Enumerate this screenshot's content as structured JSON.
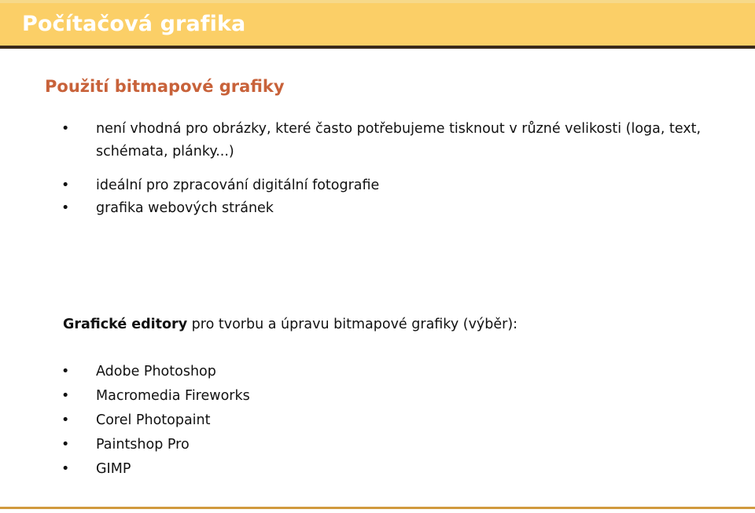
{
  "slide": {
    "header": {
      "title": "Počítačová grafika",
      "band_color": "#FBCF67",
      "top_strip_color": "#F6D98A",
      "rule_color": "#3A2A1A",
      "title_color": "#FFFFFF"
    },
    "subtitle": {
      "text": "Použití bitmapové grafiky",
      "color": "#C8623A"
    },
    "bullets": [
      {
        "text": "není vhodná pro obrázky, které často potřebujeme tisknout v různé velikosti (loga, text, schémata, plánky...)"
      },
      {
        "text": "ideální pro zpracování digitální fotografie"
      },
      {
        "text": "grafika webových stránek"
      }
    ],
    "editors_heading": {
      "bold_part": "Grafické editory",
      "rest_part": " pro tvorbu a úpravu bitmapové grafiky (výběr):"
    },
    "editors": [
      {
        "text": "Adobe Photoshop"
      },
      {
        "text": "Macromedia Fireworks"
      },
      {
        "text": "Corel Photopaint"
      },
      {
        "text": "Paintshop Pro"
      },
      {
        "text": "GIMP"
      }
    ],
    "bullet_glyph": "•",
    "footer": {
      "rule_color": "#D19A3E"
    }
  }
}
